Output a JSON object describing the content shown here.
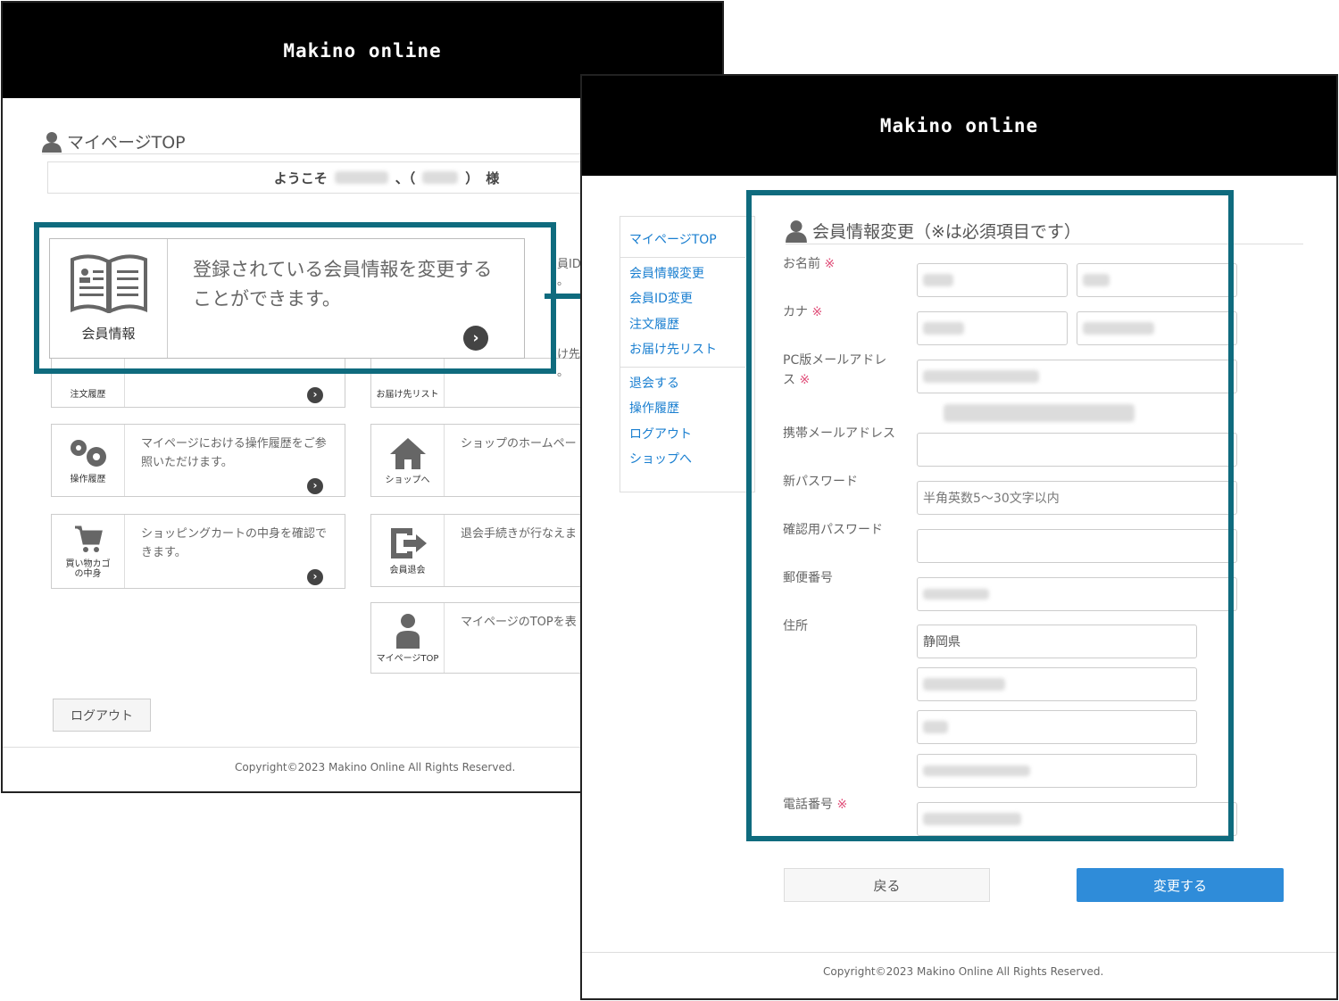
{
  "colors": {
    "accent": "#0f6b7e",
    "link": "#1a7fd0",
    "primary_button": "#2f8cd9",
    "required": "#e0507a",
    "header_bg": "#000000"
  },
  "mypage": {
    "logo": "Makino online",
    "title": "マイページTOP",
    "welcome_prefix": "ようこそ",
    "welcome_suffix": "様",
    "member_card": {
      "label": "会員情報",
      "description": "登録されている会員情報を変更することができます。"
    },
    "cards": [
      {
        "label": "注文履歴",
        "description": ""
      },
      {
        "label": "お届け先リスト",
        "description": ""
      },
      {
        "label": "操作履歴",
        "description": "マイページにおける操作履歴をご参照いただけます。"
      },
      {
        "label": "ショップへ",
        "description": "ショップのホームペー す。"
      },
      {
        "label": "買い物カゴの中身",
        "description": "ショッピングカートの中身を確認できます。"
      },
      {
        "label": "会員退会",
        "description": "退会手続きが行なえま"
      },
      {
        "label": "マイページTOP",
        "description": "マイページのTOPを表"
      }
    ],
    "partial_texts": [
      "員ID",
      "。",
      "け先",
      "。"
    ],
    "logout": "ログアウト",
    "copyright": "Copyright©2023 Makino Online All Rights Reserved."
  },
  "edit": {
    "logo": "Makino online",
    "sidebar": [
      "マイページTOP",
      "会員情報変更",
      "会員ID変更",
      "注文履歴",
      "お届け先リスト",
      "退会する",
      "操作履歴",
      "ログアウト",
      "ショップへ"
    ],
    "title": "会員情報変更（※は必須項目です）",
    "required_mark": "※",
    "labels": {
      "name": "お名前",
      "kana": "カナ",
      "pc_email": "PC版メールアドレス",
      "mobile_email": "携帯メールアドレス",
      "new_password": "新パスワード",
      "confirm_password": "確認用パスワード",
      "postal": "郵便番号",
      "address": "住所",
      "phone": "電話番号"
    },
    "fields": {
      "password_placeholder": "半角英数5～30文字以内",
      "prefecture": "静岡県"
    },
    "back_button": "戻る",
    "submit_button": "変更する",
    "copyright": "Copyright©2023 Makino Online All Rights Reserved."
  }
}
